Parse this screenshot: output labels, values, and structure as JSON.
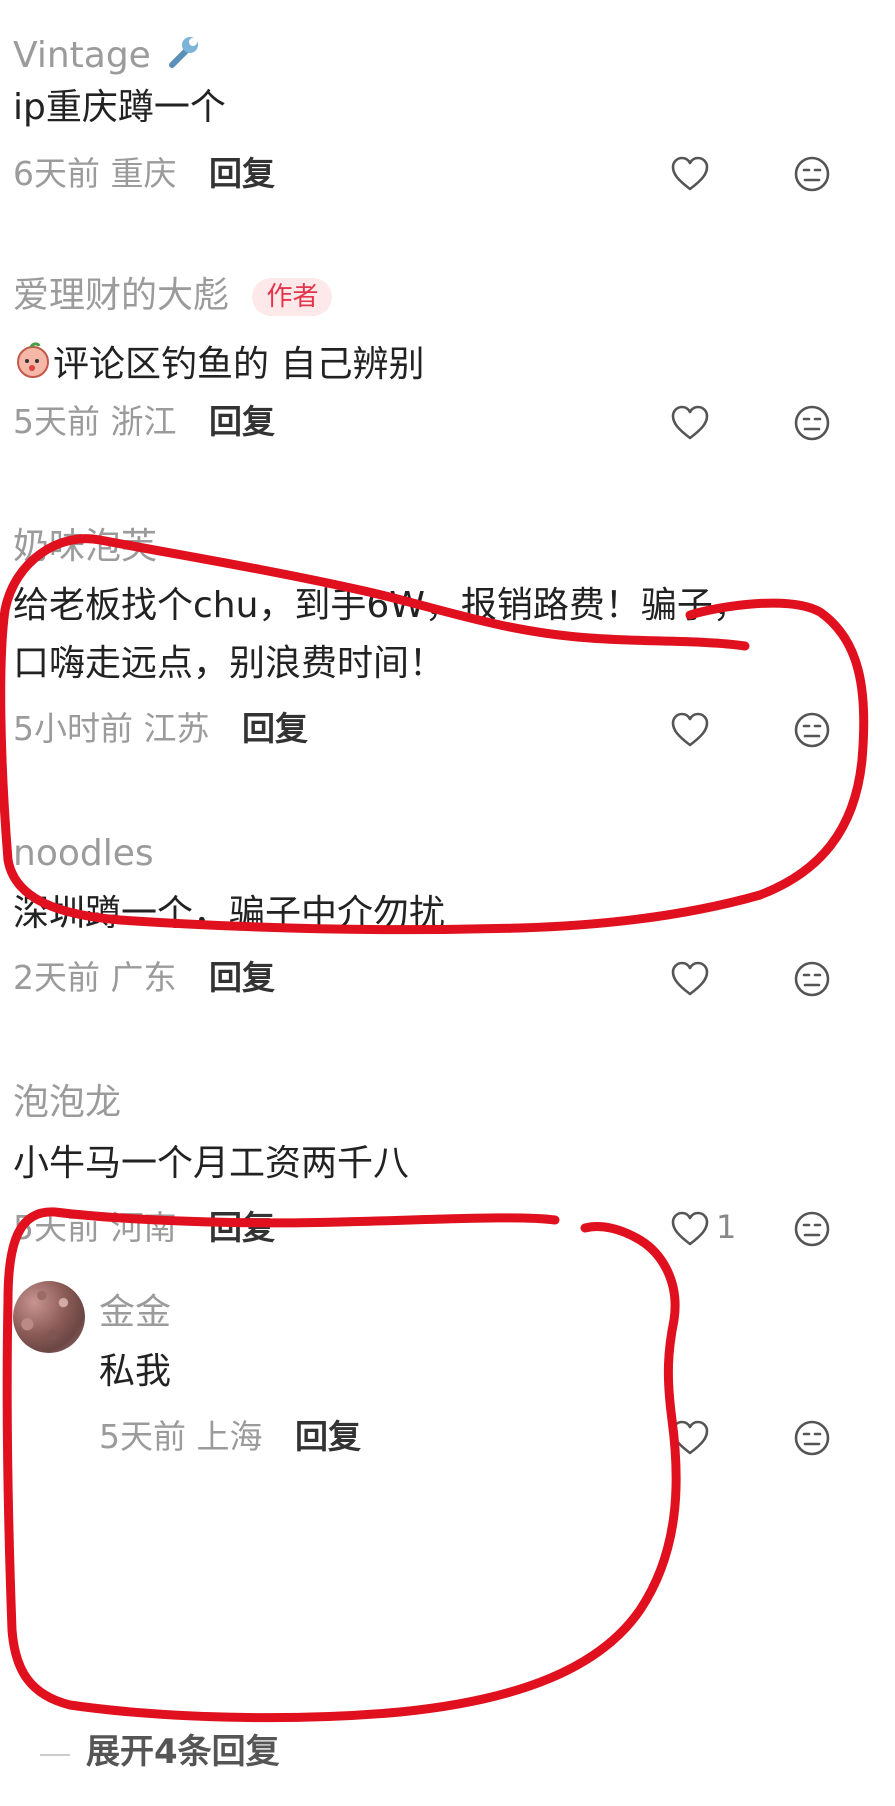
{
  "comments": [
    {
      "username": "Vintage",
      "text": "ip重庆蹲一个",
      "time": "6天前",
      "location": "重庆",
      "reply_label": "回复"
    },
    {
      "username": "爱理财的大彪",
      "author_tag": "作者",
      "text": "评论区钓鱼的 自己辨别",
      "time": "5天前",
      "location": "浙江",
      "reply_label": "回复"
    },
    {
      "username": "奶味泡芙",
      "text_line1": "给老板找个chu，到手6W，报销路费！骗子，",
      "text_line2": "口嗨走远点，别浪费时间！",
      "time": "5小时前",
      "location": "江苏",
      "reply_label": "回复"
    },
    {
      "username": "noodles",
      "text": "深圳蹲一个，骗子中介勿扰",
      "time": "2天前",
      "location": "广东",
      "reply_label": "回复"
    },
    {
      "username": "泡泡龙",
      "text": "小牛马一个月工资两千八",
      "time": "5天前",
      "location": "河南",
      "reply_label": "回复",
      "like_count": "1"
    }
  ],
  "sub_reply": {
    "username": "金金",
    "text": "私我",
    "time": "5天前",
    "location": "上海",
    "reply_label": "回复"
  },
  "expand_label": "展开4条回复",
  "icons": {
    "like": "heart-icon",
    "dislike": "neutral-face-icon",
    "wrench": "wrench-icon",
    "sticker": "peach-sticker-icon"
  },
  "colors": {
    "accent_red": "#e2364d",
    "annotation_red": "#e0101e"
  }
}
